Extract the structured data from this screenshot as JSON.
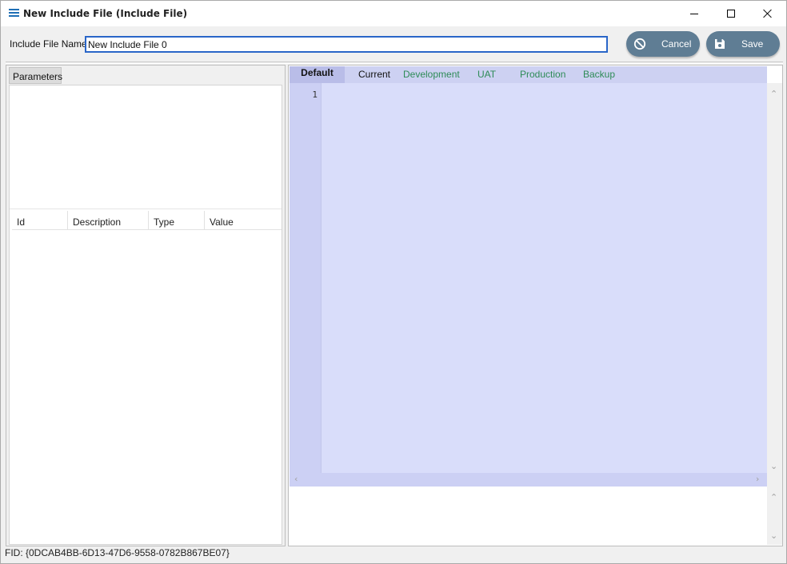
{
  "window": {
    "title": "New Include File (Include File)",
    "controls": {
      "minimize": "minimize",
      "maximize": "maximize",
      "close": "close"
    }
  },
  "header": {
    "name_label": "Include File Name",
    "name_value": "New Include File 0",
    "cancel_label": "Cancel",
    "save_label": "Save"
  },
  "left_panel": {
    "tab_label": "Parameters",
    "grid_columns": [
      "Id",
      "Description",
      "Type",
      "Value"
    ]
  },
  "editor": {
    "tabs": [
      "Default",
      "Current",
      "Development",
      "UAT",
      "Production",
      "Backup"
    ],
    "active_tab": "Default",
    "line_numbers": [
      "1"
    ]
  },
  "footer": {
    "fid": "FID: {0DCAB4BB-6D13-47D6-9558-0782B867BE07}"
  },
  "colors": {
    "accent_button": "#5f7d94",
    "tab_text_green": "#2e8b57",
    "editor_bg": "#d9ddfa",
    "input_border": "#2a66c8"
  },
  "icons": {
    "title": "list-icon",
    "cancel": "ban-icon",
    "save": "floppy-disk-icon"
  }
}
